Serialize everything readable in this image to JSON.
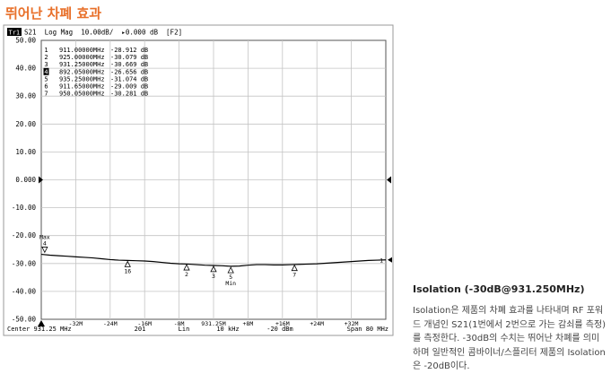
{
  "page": {
    "title": "뛰어난 차폐 효과"
  },
  "description": {
    "title": "Isolation (-30dB@931.250MHz)",
    "body": "Isolation은 제품의 차폐 효과를 나타내며 RF 포워드 개념인 S21(1번에서 2번으로 가는 감쇠를 측정)를 측정한다. -30dB의 수치는 뛰어난 차폐를 의미하며 일반적인 콤바이너/스플리터 제품의 Isolation은 -20dB이다."
  },
  "chart_data": {
    "type": "line",
    "header": {
      "trace_tag": "Tr1",
      "text": "S21  Log Mag  10.00dB/  ▸0.000 dB  [F2]"
    },
    "ylim": [
      -50,
      50
    ],
    "yticks": [
      {
        "v": 50,
        "label": "50.00"
      },
      {
        "v": 40,
        "label": "40.00"
      },
      {
        "v": 30,
        "label": "30.00"
      },
      {
        "v": 20,
        "label": "20.00"
      },
      {
        "v": 10,
        "label": "10.00"
      },
      {
        "v": 0,
        "label": "0.000"
      },
      {
        "v": -10,
        "label": "-10.00"
      },
      {
        "v": -20,
        "label": "-20.00"
      },
      {
        "v": -30,
        "label": "-30.00"
      },
      {
        "v": -40,
        "label": "-40.00"
      },
      {
        "v": -50,
        "label": "-50.00"
      }
    ],
    "xlim": [
      891.25,
      971.25
    ],
    "x_unit": "MHz",
    "x_grid_labels": [
      {
        "x": 899.25,
        "label": "-32M"
      },
      {
        "x": 907.25,
        "label": "-24M"
      },
      {
        "x": 915.25,
        "label": "-16M"
      },
      {
        "x": 923.25,
        "label": "-8M"
      },
      {
        "x": 931.25,
        "label": "931.25M"
      },
      {
        "x": 939.25,
        "label": "+8M"
      },
      {
        "x": 947.25,
        "label": "+16M"
      },
      {
        "x": 955.25,
        "label": "+24M"
      },
      {
        "x": 963.25,
        "label": "+32M"
      }
    ],
    "footer": {
      "center": "Center  931.25 MHz",
      "points": "201",
      "sweep": "Lin",
      "ifbw": "10 kHz",
      "power": "-20 dBm",
      "span": "Span  80 MHz"
    },
    "series": [
      {
        "color": "#000000",
        "x": [
          891.25,
          893.25,
          895.25,
          897.25,
          899.25,
          901.25,
          903.25,
          905.25,
          907.25,
          909.25,
          911.25,
          913.25,
          915.25,
          917.25,
          919.25,
          921.25,
          923.25,
          925.25,
          927.25,
          929.25,
          931.25,
          933.25,
          935.25,
          937.25,
          939.25,
          941.25,
          943.25,
          945.25,
          947.25,
          949.25,
          951.25,
          953.25,
          955.25,
          957.25,
          959.25,
          961.25,
          963.25,
          965.25,
          967.25,
          969.25,
          971.25
        ],
        "y": [
          -26.7,
          -27.0,
          -27.2,
          -27.4,
          -27.6,
          -27.8,
          -28.0,
          -28.3,
          -28.6,
          -28.8,
          -28.9,
          -29.0,
          -29.1,
          -29.3,
          -29.6,
          -29.9,
          -30.1,
          -30.2,
          -30.4,
          -30.6,
          -30.7,
          -30.8,
          -31.0,
          -30.9,
          -30.6,
          -30.4,
          -30.4,
          -30.5,
          -30.5,
          -30.4,
          -30.3,
          -30.2,
          -30.1,
          -29.9,
          -29.7,
          -29.5,
          -29.3,
          -29.1,
          -28.9,
          -28.8,
          -28.7
        ]
      }
    ],
    "marker_table": [
      {
        "id": "1",
        "freq": "911.00000MHz",
        "val": "-28.912 dB",
        "active": false
      },
      {
        "id": "2",
        "freq": "925.00000MHz",
        "val": "-30.079 dB",
        "active": false
      },
      {
        "id": "3",
        "freq": "931.25000MHz",
        "val": "-30.669 dB",
        "active": false
      },
      {
        "id": "4",
        "freq": "892.05000MHz",
        "val": "-26.656 dB",
        "active": true
      },
      {
        "id": "5",
        "freq": "935.25000MHz",
        "val": "-31.074 dB",
        "active": false
      },
      {
        "id": "6",
        "freq": "911.65000MHz",
        "val": "-29.009 dB",
        "active": false
      },
      {
        "id": "7",
        "freq": "950.05000MHz",
        "val": "-30.281 dB",
        "active": false
      }
    ],
    "markers": [
      {
        "label": "16",
        "x": 911.3,
        "y": -28.91
      },
      {
        "label": "2",
        "x": 925.0,
        "y": -30.08
      },
      {
        "label": "3",
        "x": 931.25,
        "y": -30.67
      },
      {
        "label": "5",
        "x": 935.25,
        "y": -31.07,
        "note": "Min"
      },
      {
        "label": "7",
        "x": 950.05,
        "y": -30.28
      },
      {
        "label": "4",
        "x": 892.05,
        "y": -26.66,
        "note": "Max"
      }
    ],
    "ref_marker": {
      "label": "1"
    }
  }
}
